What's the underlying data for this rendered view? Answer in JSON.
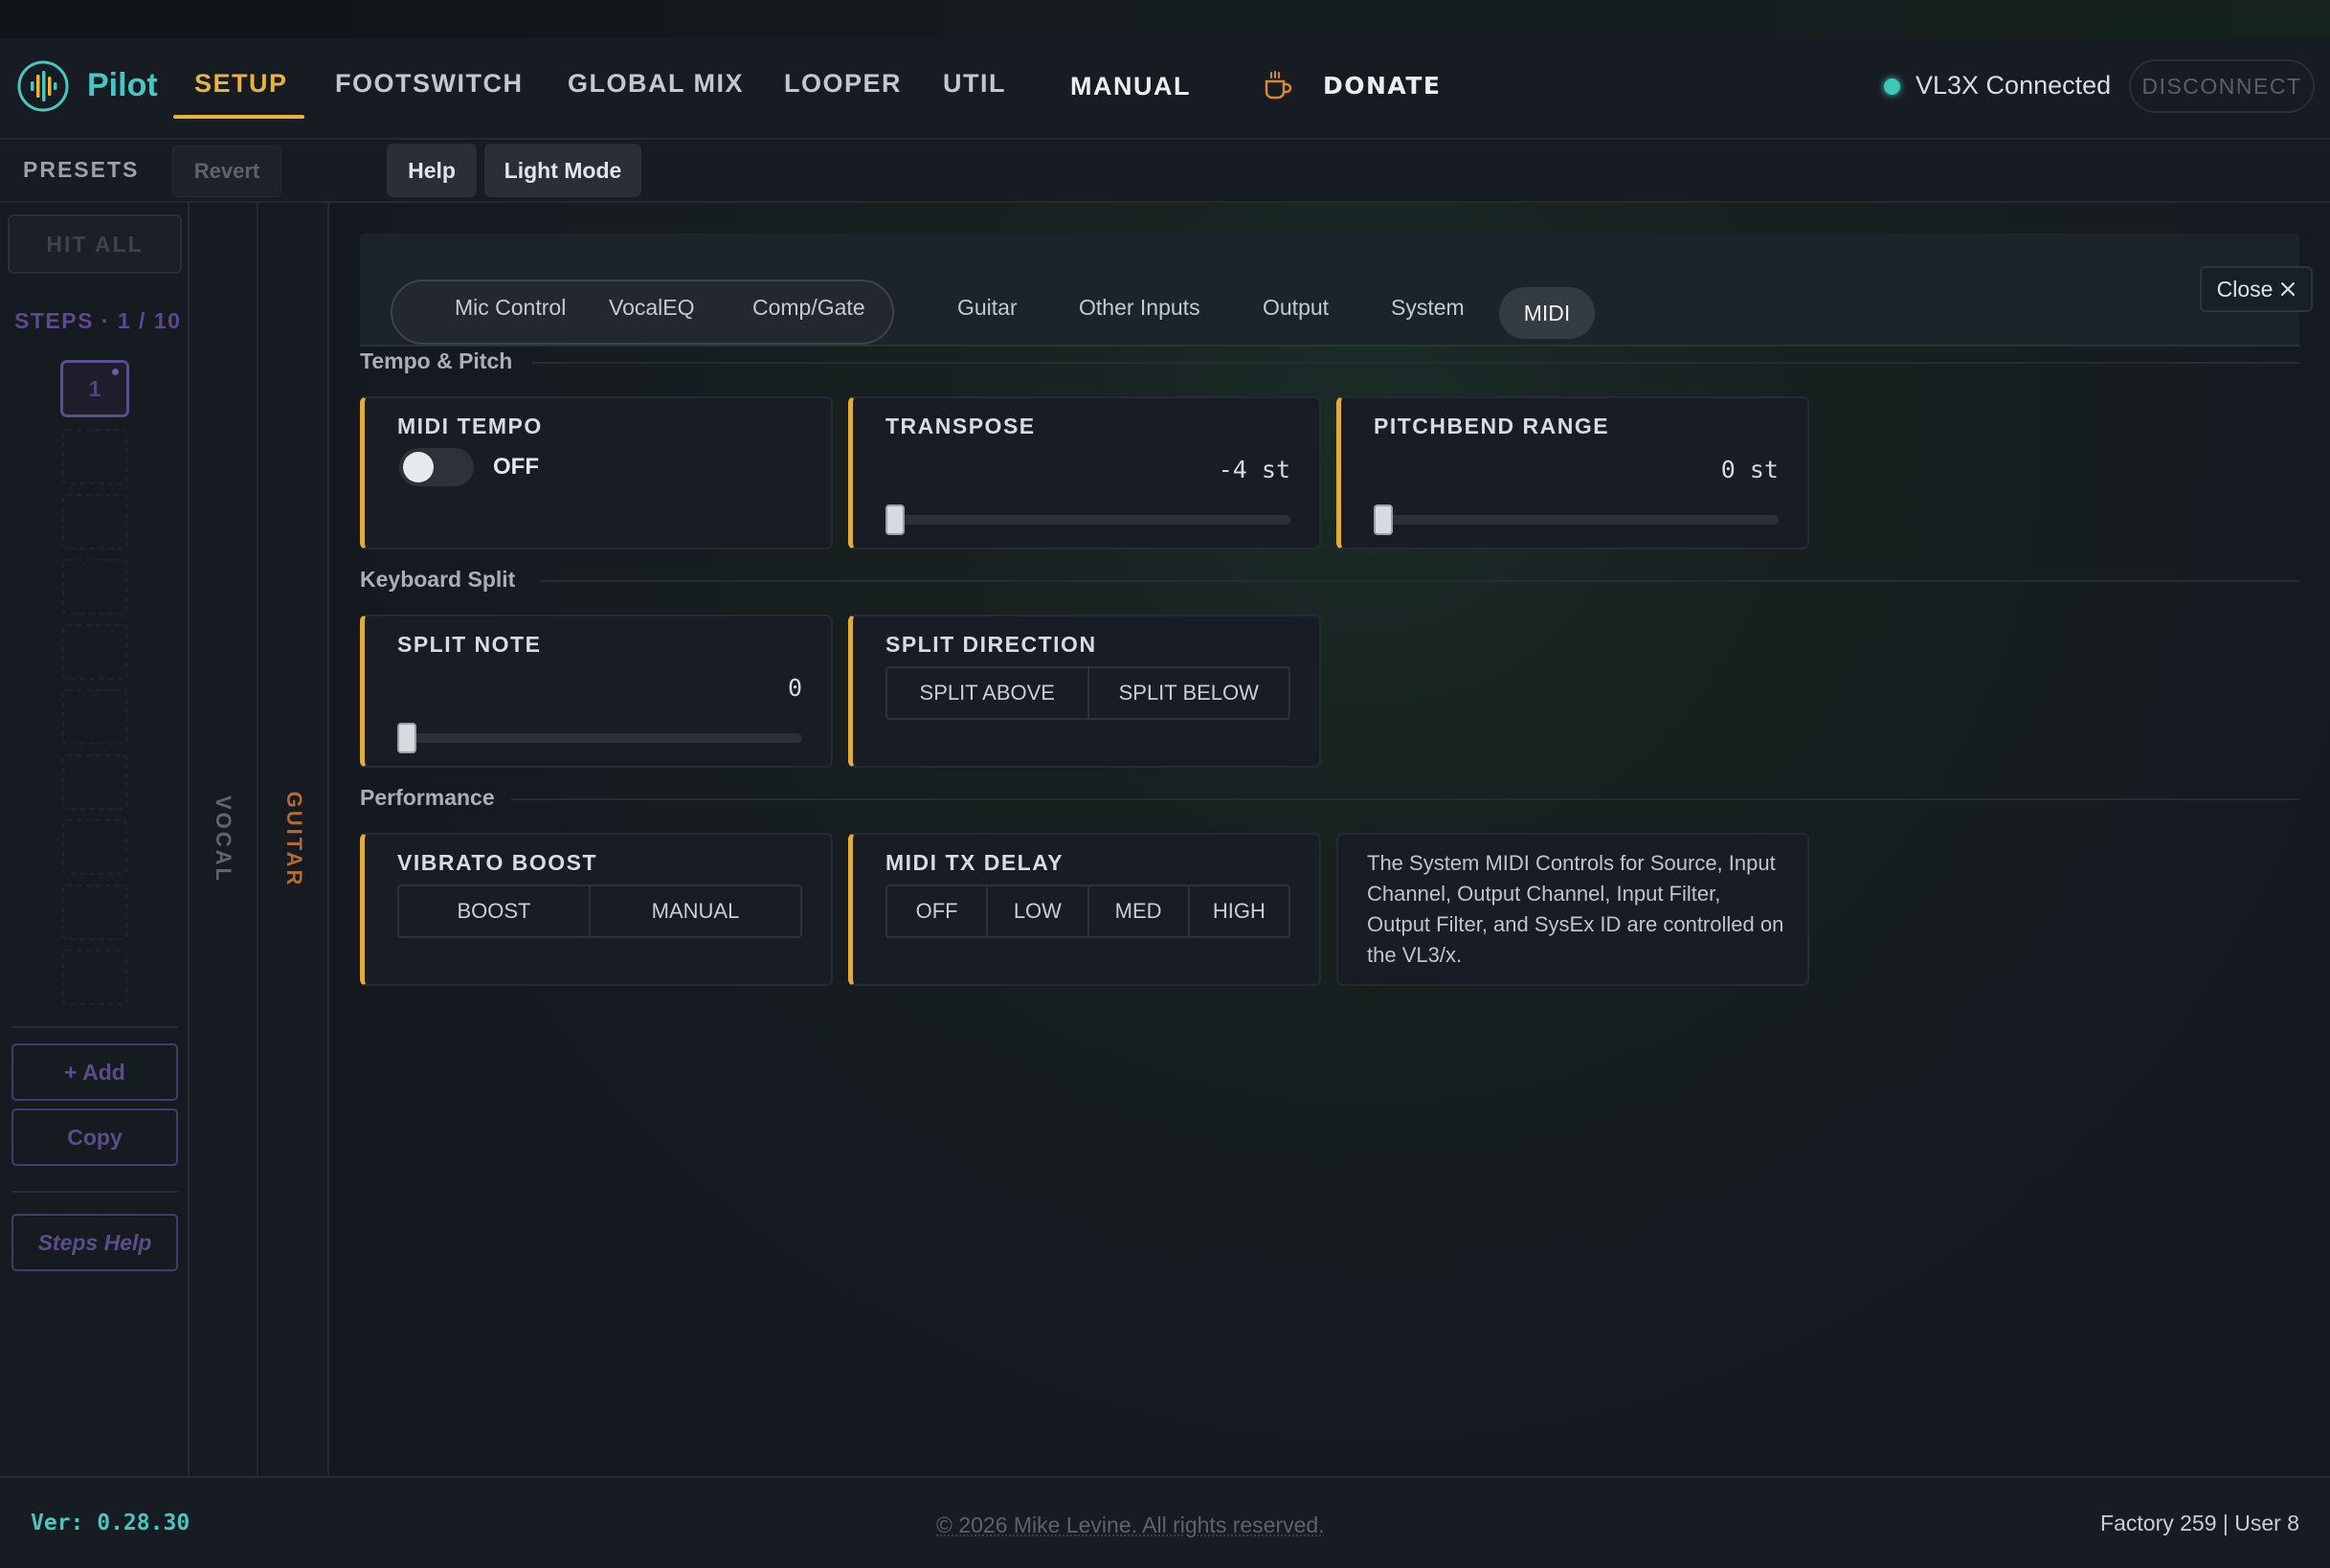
{
  "app": {
    "name": "Pilot"
  },
  "nav": {
    "tabs": [
      "SETUP",
      "FOOTSWITCH",
      "GLOBAL MIX",
      "LOOPER",
      "UTIL",
      "MANUAL",
      "DONATE"
    ],
    "active": "SETUP"
  },
  "connection": {
    "status": "VL3X Connected",
    "disconnect_label": "DISCONNECT"
  },
  "subbar": {
    "presets_label": "PRESETS",
    "revert": "Revert",
    "help": "Help",
    "light_mode": "Light Mode"
  },
  "sidebar": {
    "hit_all": "HIT ALL",
    "steps_label": "STEPS · 1 / 10",
    "active_step": "1",
    "add": "+ Add",
    "copy": "Copy",
    "steps_help": "Steps Help"
  },
  "columns": {
    "vocal": "VOCAL",
    "guitar": "GUITAR"
  },
  "panel": {
    "tabs": [
      "Mic Control",
      "VocalEQ",
      "Comp/Gate",
      "Guitar",
      "Other Inputs",
      "Output",
      "System",
      "MIDI"
    ],
    "active_tab": "MIDI",
    "close": "Close"
  },
  "sections": {
    "tempo_pitch": {
      "title": "Tempo & Pitch",
      "midi_tempo": {
        "label": "MIDI TEMPO",
        "state": "OFF"
      },
      "transpose": {
        "label": "TRANSPOSE",
        "value": "-4 st",
        "slider_fraction": 0.0
      },
      "pitchbend": {
        "label": "PITCHBEND RANGE",
        "value": "0 st",
        "slider_fraction": 0.0
      }
    },
    "keyboard_split": {
      "title": "Keyboard Split",
      "split_note": {
        "label": "SPLIT NOTE",
        "value": "0",
        "slider_fraction": 0.0
      },
      "split_direction": {
        "label": "SPLIT DIRECTION",
        "options": [
          "SPLIT ABOVE",
          "SPLIT BELOW"
        ]
      }
    },
    "performance": {
      "title": "Performance",
      "vibrato_boost": {
        "label": "VIBRATO BOOST",
        "options": [
          "BOOST",
          "MANUAL"
        ]
      },
      "midi_tx_delay": {
        "label": "MIDI TX DELAY",
        "options": [
          "OFF",
          "LOW",
          "MED",
          "HIGH"
        ]
      },
      "note": "The System MIDI Controls for Source, Input Channel, Output Channel, Input Filter, Output Filter, and SysEx ID are controlled on the VL3/x."
    }
  },
  "footer": {
    "version": "Ver: 0.28.30",
    "copyright": "© 2026 Mike Levine. All rights reserved.",
    "counts": "Factory 259 | User 8"
  },
  "colors": {
    "accent": "#e9b241",
    "teal": "#48c6c2",
    "purple": "#5b4e88",
    "guitar_label": "#b06a3a"
  },
  "icons": {
    "logo": "waveform-logo-icon",
    "donate": "coffee-cup-icon",
    "close": "close-icon",
    "status": "status-dot-icon"
  }
}
